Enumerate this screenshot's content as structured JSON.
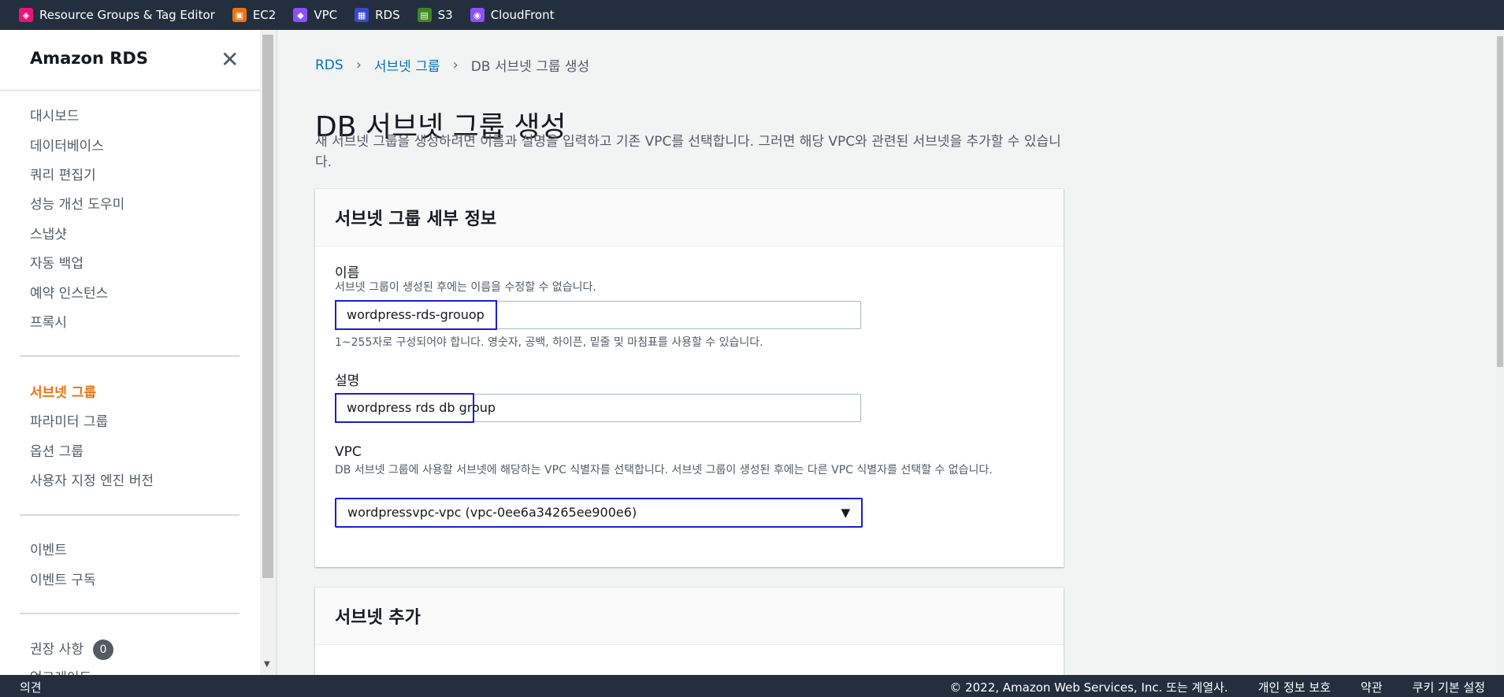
{
  "favorites": [
    {
      "label": "Resource Groups & Tag Editor",
      "icon": "resource-groups-icon",
      "color": "#e7157b"
    },
    {
      "label": "EC2",
      "icon": "ec2-icon",
      "color": "#ec7211"
    },
    {
      "label": "VPC",
      "icon": "vpc-icon",
      "color": "#8c4fff"
    },
    {
      "label": "RDS",
      "icon": "rds-icon",
      "color": "#3b48cc"
    },
    {
      "label": "S3",
      "icon": "s3-icon",
      "color": "#3f8624"
    },
    {
      "label": "CloudFront",
      "icon": "cloudfront-icon",
      "color": "#8c4fff"
    }
  ],
  "sidebar": {
    "title": "Amazon RDS",
    "close_icon": "close-icon",
    "group1": [
      "대시보드",
      "데이터베이스",
      "쿼리 편집기",
      "성능 개선 도우미",
      "스냅샷",
      "자동 백업",
      "예약 인스턴스",
      "프록시"
    ],
    "group2": [
      "서브넷 그룹",
      "파라미터 그룹",
      "옵션 그룹",
      "사용자 지정 엔진 버전"
    ],
    "group3": [
      "이벤트",
      "이벤트 구독"
    ],
    "group4": {
      "label": "권장 사항",
      "badge": "0"
    },
    "cut_item": "업그레이드"
  },
  "breadcrumb": {
    "items": [
      "RDS",
      "서브넷 그룹"
    ],
    "current": "DB 서브넷 그룹 생성"
  },
  "page": {
    "title": "DB 서브넷 그룹 생성",
    "description": "새 서브넷 그룹을 생성하려면 이름과 설명을 입력하고 기존 VPC를 선택합니다. 그러면 해당 VPC와 관련된 서브넷을 추가할 수 있습니다."
  },
  "details_panel": {
    "title": "서브넷 그룹 세부 정보",
    "name_label": "이름",
    "name_desc": "서브넷 그룹이 생성된 후에는 이름을 수정할 수 없습니다.",
    "name_value": "wordpress-rds-grouop",
    "name_help": "1~255자로 구성되어야 합니다. 영숫자, 공백, 하이픈, 밑줄 및 마침표를 사용할 수 있습니다.",
    "desc_label": "설명",
    "desc_value": "wordpress rds db group",
    "vpc_label": "VPC",
    "vpc_desc": "DB 서브넷 그룹에 사용할 서브넷에 해당하는 VPC 식별자를 선택합니다. 서브넷 그룹이 생성된 후에는 다른 VPC 식별자를 선택할 수 없습니다.",
    "vpc_value": "wordpressvpc-vpc (vpc-0ee6a34265ee900e6)"
  },
  "add_subnet_panel": {
    "title": "서브넷 추가"
  },
  "footer": {
    "feedback": "의견",
    "copyright": "© 2022, Amazon Web Services, Inc. 또는 계열사.",
    "privacy": "개인 정보 보호",
    "terms": "약관",
    "cookies": "쿠키 기본 설정"
  }
}
